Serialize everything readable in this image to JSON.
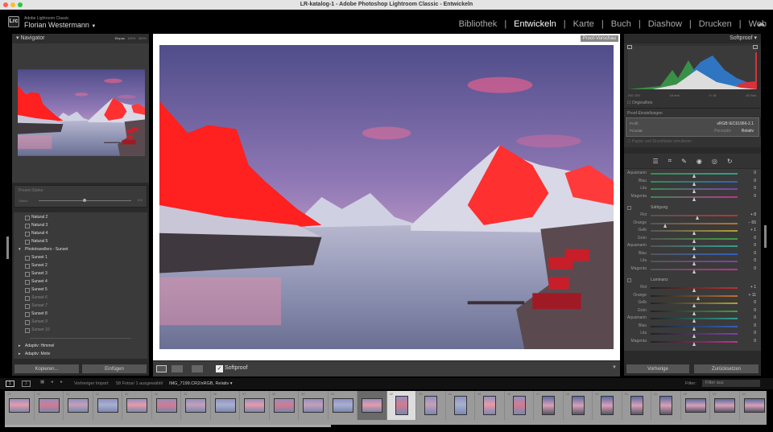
{
  "window": {
    "title": "LR-katalog-1 - Adobe Photoshop Lightroom Classic - Entwickeln"
  },
  "identity": {
    "app": "Adobe Lightroom Classic",
    "user": "Florian Westermann",
    "logo": "Lrc"
  },
  "modules": [
    {
      "label": "Bibliothek",
      "active": false
    },
    {
      "label": "Entwickeln",
      "active": true
    },
    {
      "label": "Karte",
      "active": false
    },
    {
      "label": "Buch",
      "active": false
    },
    {
      "label": "Diashow",
      "active": false
    },
    {
      "label": "Drucken",
      "active": false
    },
    {
      "label": "Web",
      "active": false
    }
  ],
  "navigator": {
    "title": "Navigator",
    "zoom_options": [
      "Einpas",
      "100%",
      "300%"
    ]
  },
  "preset_amount": {
    "label": "Preset-Stärke",
    "sub": "Stärke",
    "value": "100"
  },
  "presets": [
    {
      "type": "item",
      "label": "Natural 2"
    },
    {
      "type": "item",
      "label": "Natural 3"
    },
    {
      "type": "item",
      "label": "Natural 4"
    },
    {
      "type": "item",
      "label": "Natural 5"
    },
    {
      "type": "group-open",
      "label": "Phototravellers - Sunset"
    },
    {
      "type": "item",
      "label": "Sunset 1"
    },
    {
      "type": "item",
      "label": "Sunset 2"
    },
    {
      "type": "item",
      "label": "Sunset 3"
    },
    {
      "type": "item",
      "label": "Sunset 4"
    },
    {
      "type": "item",
      "label": "Sunset 5"
    },
    {
      "type": "dim",
      "label": "Sunset 6"
    },
    {
      "type": "dim",
      "label": "Sunset 7"
    },
    {
      "type": "item",
      "label": "Sunset 8"
    },
    {
      "type": "dim",
      "label": "Sunset 9"
    },
    {
      "type": "dim",
      "label": "Sunset 10"
    },
    {
      "type": "group",
      "label": "Adaptiv: Himmel"
    },
    {
      "type": "group",
      "label": "Adaptiv: Motiv"
    }
  ],
  "left_buttons": {
    "copy": "Kopieren...",
    "paste": "Einfügen"
  },
  "preview": {
    "badge": "Proof-Vorschau"
  },
  "toolbar": {
    "softproof_label": "Softproof",
    "softproof_checked": true
  },
  "right": {
    "panel_title": "Softproof",
    "histogram": {
      "iso": "ISO 100",
      "focal": "16 mm",
      "aperture": "f / 18",
      "shutter": "40 Sek.",
      "original_label": "Originalfoto"
    },
    "proof": {
      "title": "Proof-Einstellungen",
      "profile_label": "Profil:",
      "profile_value": "sRGB IEC61966-2.1",
      "intent_label": "Priorität:",
      "intent_options": [
        "Perzeptiv",
        "Relativ"
      ],
      "intent_selected": "Relativ",
      "simulate_label": "Papier und Druckfarbe simulieren"
    },
    "tools": [
      "sliders-icon",
      "crop-icon",
      "heal-icon",
      "redeye-icon",
      "mask-icon",
      "reset-icon"
    ],
    "hue_rows": [
      {
        "label": "Aquamarin",
        "value": "0",
        "pos": 0
      },
      {
        "label": "Blau",
        "value": "0",
        "pos": 0
      },
      {
        "label": "Lila",
        "value": "0",
        "pos": 0
      },
      {
        "label": "Magenta",
        "value": "0",
        "pos": 0
      }
    ],
    "saturation": {
      "title": "Sättigung",
      "rows": [
        {
          "label": "Rot",
          "value": "+ 8",
          "pos": 8
        },
        {
          "label": "Orange",
          "value": "− 65",
          "pos": -65
        },
        {
          "label": "Gelb",
          "value": "+ 1",
          "pos": 1
        },
        {
          "label": "Grün",
          "value": "0",
          "pos": 0
        },
        {
          "label": "Aquamarin",
          "value": "0",
          "pos": 0
        },
        {
          "label": "Blau",
          "value": "0",
          "pos": 0
        },
        {
          "label": "Lila",
          "value": "0",
          "pos": 0
        },
        {
          "label": "Magenta",
          "value": "0",
          "pos": 0
        }
      ]
    },
    "luminance": {
      "title": "Luminanz",
      "rows": [
        {
          "label": "Rot",
          "value": "+ 1",
          "pos": 1
        },
        {
          "label": "Orange",
          "value": "+ 11",
          "pos": 11
        },
        {
          "label": "Gelb",
          "value": "0",
          "pos": 0
        },
        {
          "label": "Grün",
          "value": "0",
          "pos": 0
        },
        {
          "label": "Aquamarin",
          "value": "0",
          "pos": 0
        },
        {
          "label": "Blau",
          "value": "0",
          "pos": 0
        },
        {
          "label": "Lila",
          "value": "0",
          "pos": 0
        },
        {
          "label": "Magenta",
          "value": "0",
          "pos": 0
        }
      ]
    },
    "buttons": {
      "previous": "Vorherige",
      "reset": "Zurücksetzen"
    }
  },
  "filmstrip_bar": {
    "view1": "1",
    "view2": "2",
    "source": "Vorheriger Import",
    "count": "58 Fotos/ 1 ausgewählt/",
    "file": "IMG_7199.CR2/sRGB, Relativ",
    "filter_label": "Filter:",
    "filter_value": "Filter aus"
  },
  "filmstrip": {
    "numbers": [
      "29",
      "30",
      "31",
      "32",
      "33",
      "34",
      "35",
      "36",
      "37",
      "38",
      "39",
      "40",
      "41",
      "42",
      "43",
      "44",
      "45",
      "46",
      "47",
      "48",
      "49",
      "50",
      "51",
      "52",
      "53",
      "54",
      "55"
    ],
    "selected": "41",
    "current": "42"
  }
}
